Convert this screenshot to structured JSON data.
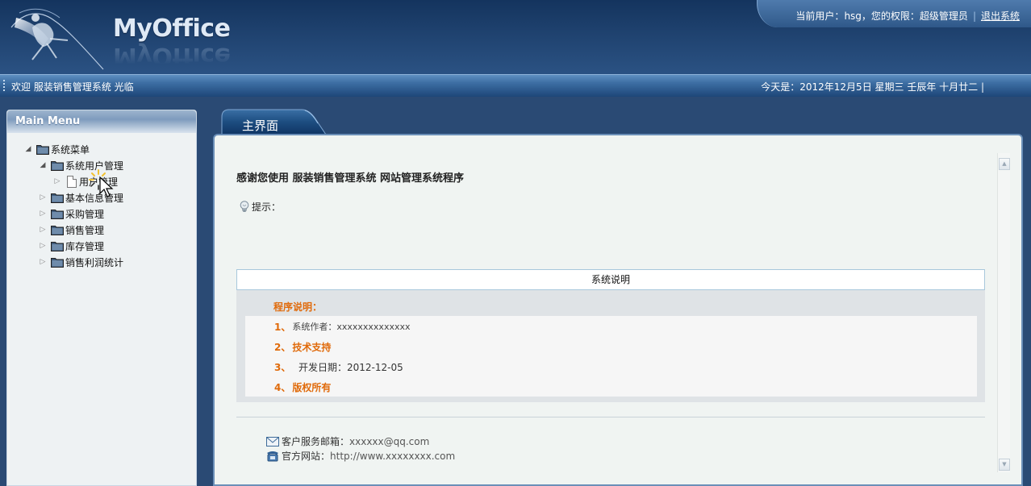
{
  "header": {
    "app_title": "MyOffice",
    "user_prefix": "当前用户：",
    "username": "hsg",
    "role_text": "，您的权限：超级管理员",
    "logout_label": "退出系统"
  },
  "status_bar": {
    "welcome": "欢迎 服装销售管理系统 光临",
    "date_text": "今天是：2012年12月5日 星期三 壬辰年 十月廿二 |"
  },
  "sidebar": {
    "title": "Main Menu",
    "tree": [
      {
        "label": "系统菜单",
        "level": 0,
        "expanded": true,
        "type": "folder"
      },
      {
        "label": "系统用户管理",
        "level": 1,
        "expanded": true,
        "type": "folder"
      },
      {
        "label": "用户管理",
        "level": 2,
        "expanded": false,
        "type": "page"
      },
      {
        "label": "基本信息管理",
        "level": 1,
        "expanded": false,
        "type": "folder"
      },
      {
        "label": "采购管理",
        "level": 1,
        "expanded": false,
        "type": "folder"
      },
      {
        "label": "销售管理",
        "level": 1,
        "expanded": false,
        "type": "folder"
      },
      {
        "label": "库存管理",
        "level": 1,
        "expanded": false,
        "type": "folder"
      },
      {
        "label": "销售利润统计",
        "level": 1,
        "expanded": false,
        "type": "folder"
      }
    ]
  },
  "main": {
    "tab_label": "主界面",
    "heading": "感谢您使用 服装销售管理系统 网站管理系统程序",
    "tip_label": "提示：",
    "description": {
      "header": "系统说明",
      "program_title": "程序说明：",
      "items": [
        {
          "num": "1、",
          "text": "系统作者：xxxxxxxxxxxxxx",
          "style": "small"
        },
        {
          "num": "2、",
          "text": "技术支持",
          "style": "orange"
        },
        {
          "num": "3、",
          "text": "  开发日期：2012-12-05",
          "style": "normal"
        },
        {
          "num": "4、",
          "text": "版权所有",
          "style": "orange"
        }
      ]
    },
    "contact": {
      "email_label": "客户服务邮箱：",
      "email_value": "xxxxxx@qq.com",
      "site_label": "官方网站：",
      "site_value": "http://www.xxxxxxxx.com"
    }
  },
  "icons": {
    "logo": "logo-graphic",
    "tip": "lightbulb-icon",
    "email": "envelope-icon",
    "site": "phone-icon",
    "folder": "folder-icon",
    "page": "page-icon",
    "cursor": "busy-cursor-icon"
  },
  "colors": {
    "header_bg": "#1f426f",
    "accent_orange": "#e06a0a",
    "panel_border": "#6b8fb8",
    "sidebar_bg": "#eef2f3"
  }
}
